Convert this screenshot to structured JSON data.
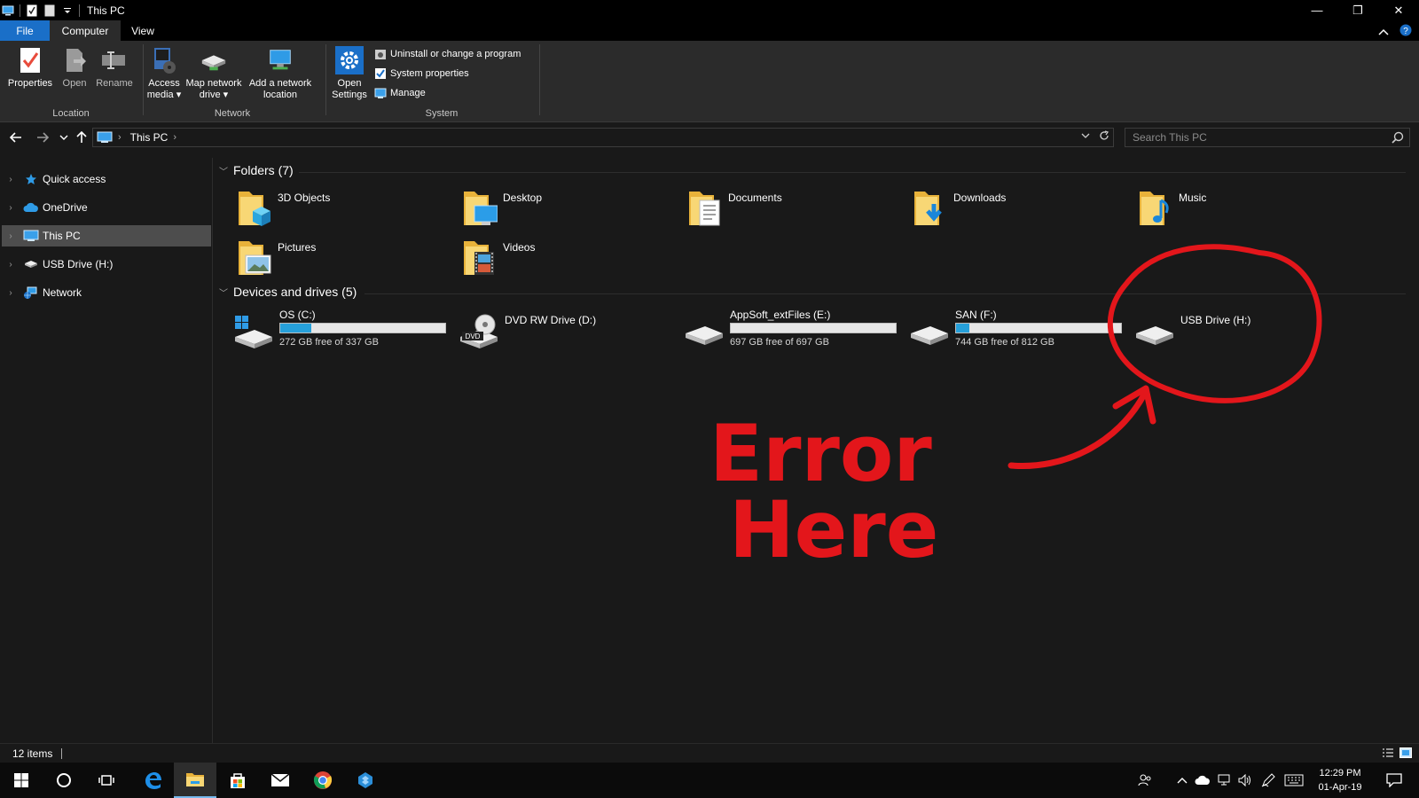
{
  "window": {
    "title": "This PC",
    "controls": {
      "minimize": "—",
      "restore": "❐",
      "close": "✕"
    }
  },
  "ribbon": {
    "tabs": {
      "file": "File",
      "computer": "Computer",
      "view": "View"
    },
    "location": {
      "label": "Location",
      "properties": "Properties",
      "open": "Open",
      "rename": "Rename"
    },
    "network": {
      "label": "Network",
      "access_media_1": "Access",
      "access_media_2": "media ▾",
      "map_drive_1": "Map network",
      "map_drive_2": "drive ▾",
      "add_location_1": "Add a network",
      "add_location_2": "location"
    },
    "system": {
      "label": "System",
      "open_settings_1": "Open",
      "open_settings_2": "Settings",
      "uninstall": "Uninstall or change a program",
      "system_properties": "System properties",
      "manage": "Manage"
    }
  },
  "address": {
    "crumb": "This PC",
    "separator": "›",
    "search_placeholder": "Search This PC"
  },
  "nav": {
    "items": [
      {
        "label": "Quick access",
        "icon": "star-icon"
      },
      {
        "label": "OneDrive",
        "icon": "cloud-icon"
      },
      {
        "label": "This PC",
        "icon": "computer-icon",
        "selected": true
      },
      {
        "label": "USB Drive (H:)",
        "icon": "usb-drive-icon"
      },
      {
        "label": "Network",
        "icon": "network-icon"
      }
    ]
  },
  "folders": {
    "header": "Folders (7)",
    "items": [
      {
        "name": "3D Objects",
        "icon": "3d-objects-folder-icon"
      },
      {
        "name": "Desktop",
        "icon": "desktop-folder-icon"
      },
      {
        "name": "Documents",
        "icon": "documents-folder-icon"
      },
      {
        "name": "Downloads",
        "icon": "downloads-folder-icon"
      },
      {
        "name": "Music",
        "icon": "music-folder-icon"
      },
      {
        "name": "Pictures",
        "icon": "pictures-folder-icon"
      },
      {
        "name": "Videos",
        "icon": "videos-folder-icon"
      }
    ]
  },
  "drives": {
    "header": "Devices and drives (5)",
    "items": [
      {
        "name": "OS (C:)",
        "free": "272 GB free of 337 GB",
        "used_fraction": 0.19,
        "icon": "windows-drive-icon"
      },
      {
        "name": "DVD RW Drive (D:)",
        "free": "",
        "icon": "dvd-drive-icon"
      },
      {
        "name": "AppSoft_extFiles (E:)",
        "free": "697 GB free of 697 GB",
        "used_fraction": 0.0,
        "icon": "hard-drive-icon"
      },
      {
        "name": "SAN (F:)",
        "free": "744 GB free of 812 GB",
        "used_fraction": 0.08,
        "icon": "hard-drive-icon"
      },
      {
        "name": "USB Drive (H:)",
        "free": "",
        "icon": "usb-drive-icon"
      }
    ]
  },
  "annotation": {
    "line1": "Error",
    "line2": "Here",
    "color": "#e3161b"
  },
  "status": {
    "count": "12 items"
  },
  "taskbar": {
    "time": "12:29 PM",
    "date": "01-Apr-19"
  },
  "colors": {
    "accent": "#1a6fc8",
    "drive_bar_fill": "#26a0da",
    "folder_yellow": "#f1c34a"
  }
}
